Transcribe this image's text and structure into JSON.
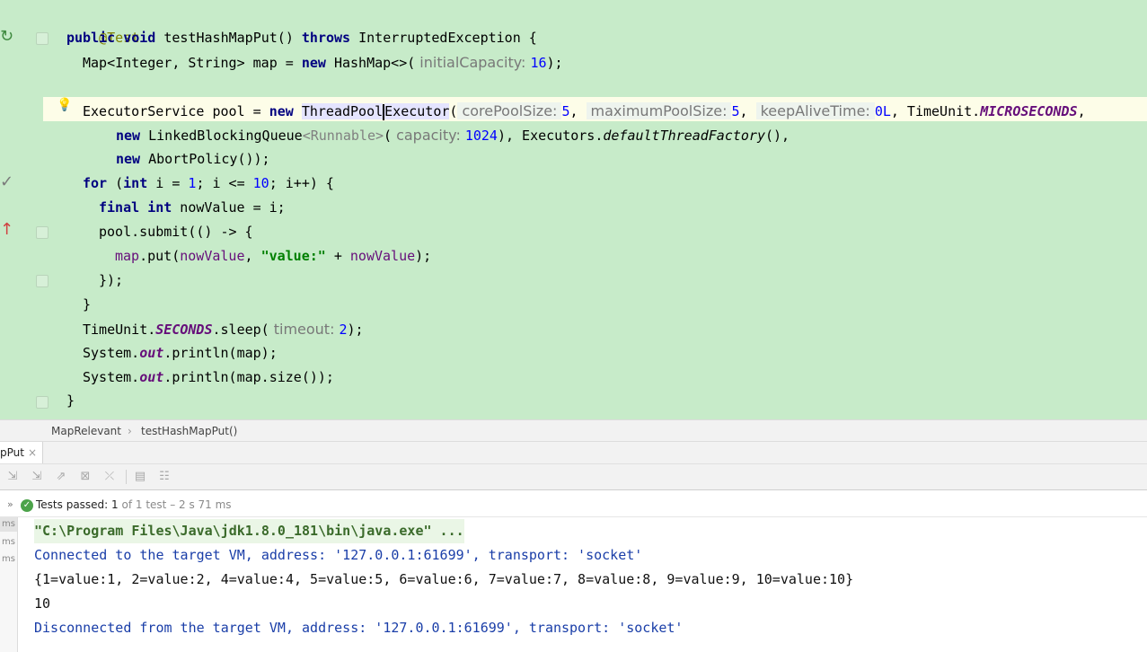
{
  "editor": {
    "annotation": "@Test",
    "method": {
      "kw_public": "public",
      "kw_void": "void",
      "name": "testHashMapPut()",
      "kw_throws": "throws",
      "exception": "InterruptedException {"
    },
    "map_decl": {
      "type": "Map<Integer, String> map = ",
      "kw_new": "new",
      "ctor": " HashMap<>(",
      "hint": "initialCapacity:",
      "value": "16",
      "tail": ");"
    },
    "pool_decl": {
      "type": "ExecutorService pool = ",
      "kw_new": "new",
      "ctor_a": "ThreadPool",
      "ctor_b": "Executor",
      "paren": "(",
      "hint1": "corePoolSize:",
      "val1": "5",
      "hint2": "maximumPoolSize:",
      "val2": "5",
      "hint3": "keepAliveTime:",
      "val3": "0L",
      "timeunit": ", TimeUnit.",
      "timeunit_const": "MICROSECONDS",
      "comma": ","
    },
    "queue_line": {
      "kw_new": "new",
      "ctor": " LinkedBlockingQueue",
      "generic": "<Runnable>",
      "paren": "(",
      "hint": "capacity:",
      "value": "1024",
      "tail_a": "), Executors.",
      "factory": "defaultThreadFactory",
      "tail_b": "(),"
    },
    "policy_line": {
      "kw_new": "new",
      "tail": " AbortPolicy());"
    },
    "for_line": {
      "kw_for": "for",
      "a": " (",
      "kw_int": "int",
      "b": " i = ",
      "n1": "1",
      "c": "; i <= ",
      "n2": "10",
      "d": "; i++) {"
    },
    "final_line": {
      "kw_final": "final",
      "kw_int": "int",
      "rest": " nowValue = i;"
    },
    "submit_line": "pool.submit(() -> {",
    "put_line": {
      "field": "map",
      "a": ".put(",
      "param": "nowValue",
      "b": ", ",
      "str": "\"value:\"",
      "c": " + ",
      "param2": "nowValue",
      "d": ");"
    },
    "close_lambda": "});",
    "close_for": "}",
    "sleep_line": {
      "a": "TimeUnit.",
      "const": "SECONDS",
      "b": ".sleep(",
      "hint": "timeout:",
      "value": "2",
      "c": ");"
    },
    "print1": {
      "a": "System.",
      "out": "out",
      "b": ".println(map);"
    },
    "print2": {
      "a": "System.",
      "out": "out",
      "b": ".println(map.size());"
    },
    "close_method": "}"
  },
  "gutter": {
    "run_icon": "↻",
    "check_icon": "✓",
    "arrow_icon": "↑",
    "bulb_icon": "💡"
  },
  "breadcrumb": {
    "class_name": "MapRelevant",
    "separator": "›",
    "method_name": "testHashMapPut()"
  },
  "run_tab": {
    "label": "pPut",
    "close": "×"
  },
  "toolbar": {
    "icons": [
      "sort-alpha-icon",
      "sort-duration-icon",
      "import-icon",
      "export-icon",
      "collapse-icon",
      "expand-icon",
      "settings-icon"
    ]
  },
  "status": {
    "expand": "»",
    "check": "✓",
    "label": "Tests passed:",
    "count": "1",
    "detail": "of 1 test – 2 s 71 ms"
  },
  "left_pane": [
    "ms",
    "ms",
    "ms"
  ],
  "console": {
    "line1": "\"C:\\Program Files\\Java\\jdk1.8.0_181\\bin\\java.exe\" ...",
    "line2": "Connected to the target VM, address: '127.0.0.1:61699', transport: 'socket'",
    "line3": "{1=value:1, 2=value:2, 4=value:4, 5=value:5, 6=value:6, 7=value:7, 8=value:8, 9=value:9, 10=value:10}",
    "line4": "10",
    "line5": "Disconnected from the target VM, address: '127.0.0.1:61699', transport: 'socket'"
  },
  "colors": {
    "editor_bg": "#c7ebc9",
    "keyword": "#000080",
    "number": "#0000ff",
    "string": "#008000",
    "static": "#660e7a",
    "annotation": "#808000",
    "console_blue": "#1a3ea8"
  }
}
